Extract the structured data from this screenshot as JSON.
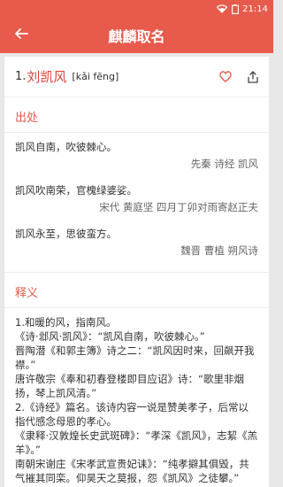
{
  "status_bar": {
    "time": "21:14"
  },
  "app_bar": {
    "title": "麒麟取名"
  },
  "word": {
    "number": "1.",
    "name": "刘凯风",
    "pinyin": "[kǎi fēng]"
  },
  "sections": {
    "origin_title": "出处",
    "meaning_title": "释义"
  },
  "sources": [
    {
      "text": "凯风自南，吹彼棘心。",
      "author": "先秦 诗经 凯风"
    },
    {
      "text": "凯风吹南荣，官槐绿婆娑。",
      "author": "宋代 黄庭坚 四月丁卯对雨寄赵正夫"
    },
    {
      "text": "凯风永至，思彼蛮方。",
      "author": "魏晋 曹植 朔风诗"
    }
  ],
  "meaning_lines": [
    "1.和暖的风，指南风。",
    "《诗·邶风·凯风》：“凯风自南，吹彼棘心。”",
    "晋陶潜《和郭主簿》诗之二：“凯风因时来，回飙开我襟。”",
    "唐许敬宗《奉和初春登楼即目应诏》诗：“歌里非烟扬，琴上凯风清。”",
    "2.《诗经》篇名。该诗内容一说是赞美孝子，后常以指代感念母恩的孝心。",
    "《隶释·汉敦煌长史武斑碑》：“孝深《凯风》，志絜《羔羊》。”",
    "南朝宋谢庄《宋孝武宣贵妃诔》：“纯孝擗其俱毁，共气摧其同栾。仰昊天之莫报，怨《凯风》之徒攀。”"
  ],
  "colors": {
    "accent": "#e85b4c",
    "section_title": "#e05a48",
    "name": "#d9463a"
  },
  "icons": [
    "wifi-icon",
    "battery-icon",
    "back-arrow-icon",
    "heart-icon",
    "share-icon"
  ]
}
